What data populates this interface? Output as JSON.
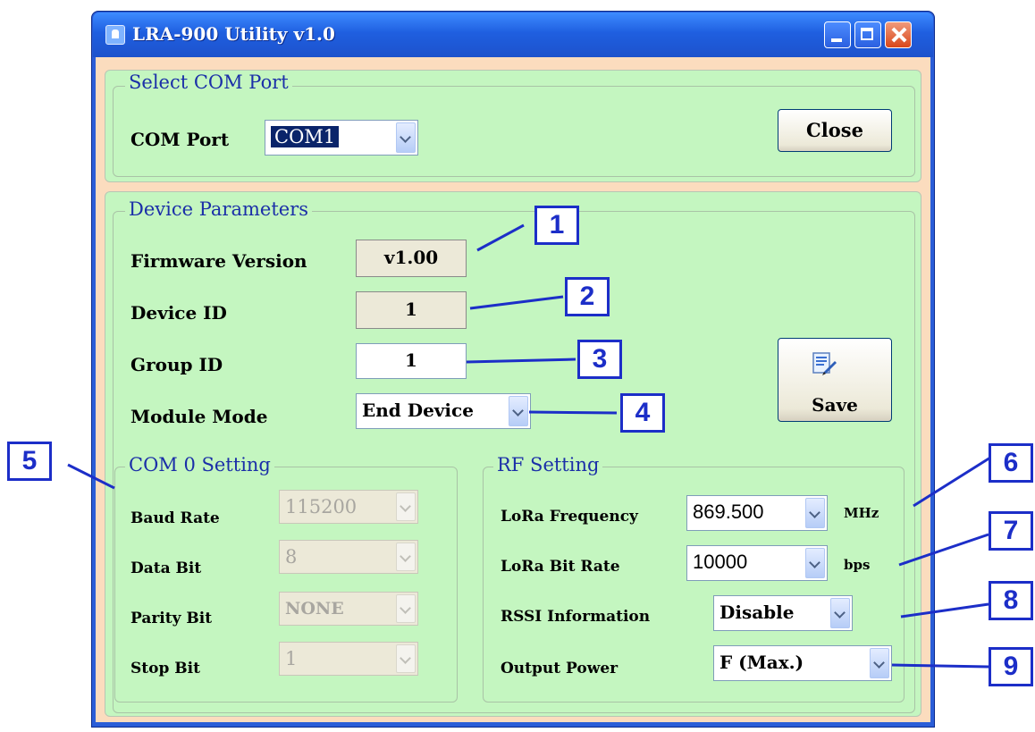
{
  "window": {
    "title": "LRA-900 Utility v1.0"
  },
  "com_port_group": {
    "title": "Select COM Port",
    "com_port_label": "COM Port",
    "com_port_value": "COM1",
    "close_label": "Close"
  },
  "device_params": {
    "title": "Device Parameters",
    "firmware_label": "Firmware Version",
    "firmware_value": "v1.00",
    "device_id_label": "Device ID",
    "device_id_value": "1",
    "group_id_label": "Group ID",
    "group_id_value": "1",
    "module_mode_label": "Module Mode",
    "module_mode_value": "End Device",
    "save_label": "Save"
  },
  "com0_setting": {
    "title": "COM 0 Setting",
    "baud_rate_label": "Baud Rate",
    "baud_rate_value": "115200",
    "data_bit_label": "Data Bit",
    "data_bit_value": "8",
    "parity_bit_label": "Parity Bit",
    "parity_bit_value": "NONE",
    "stop_bit_label": "Stop Bit",
    "stop_bit_value": "1"
  },
  "rf_setting": {
    "title": "RF Setting",
    "frequency_label": "LoRa Frequency",
    "frequency_value": "869.500",
    "frequency_unit": "MHz",
    "bit_rate_label": "LoRa Bit Rate",
    "bit_rate_value": "10000",
    "bit_rate_unit": "bps",
    "rssi_label": "RSSI Information",
    "rssi_value": "Disable",
    "output_power_label": "Output Power",
    "output_power_value": "F (Max.)"
  },
  "callouts": [
    "1",
    "2",
    "3",
    "4",
    "5",
    "6",
    "7",
    "8",
    "9"
  ],
  "colors": {
    "title_bar": "#1f5fe0",
    "client_background": "#fbdcbe",
    "group_background": "#c4f6c0",
    "group_title": "#1b2fa8",
    "callout": "#1c2ec8"
  }
}
